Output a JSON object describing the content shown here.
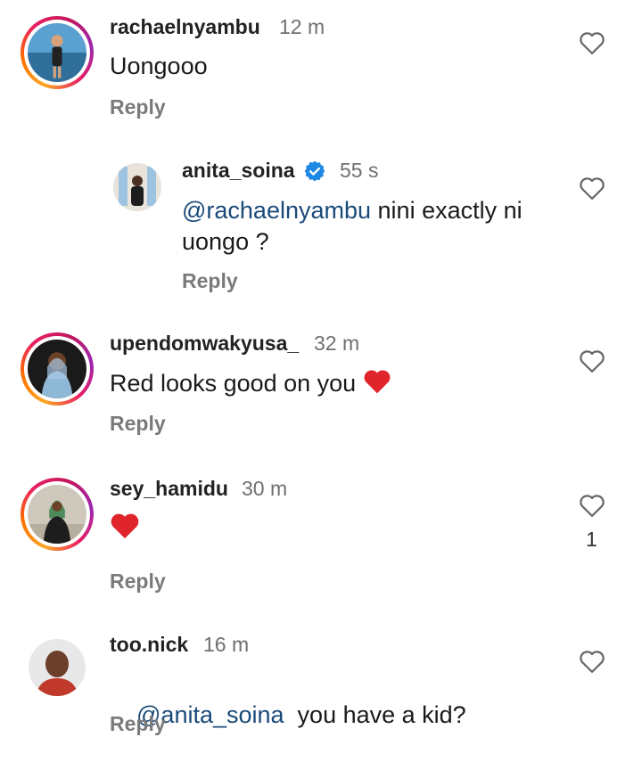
{
  "comments": [
    {
      "username": "rachaelnyambu",
      "time": "12 m",
      "text": "Uongooo",
      "reply": "Reply"
    },
    {
      "username": "anita_soina",
      "time": "55 s",
      "mention": "@rachaelnyambu",
      "text_line1": " nini exactly ni",
      "text_line2": "uongo ?",
      "reply": "Reply",
      "verified": true
    },
    {
      "username": "upendomwakyusa_",
      "time": "32 m",
      "text": "Red looks good on you",
      "emoji": "red-heart",
      "reply": "Reply"
    },
    {
      "username": "sey_hamidu",
      "time": "30 m",
      "emoji": "red-heart",
      "reply": "Reply",
      "likes": "1"
    },
    {
      "username": "too.nick",
      "time": "16 m",
      "mention": "@anita_soina",
      "text": "  you have a kid?",
      "reply": "Reply"
    }
  ],
  "colors": {
    "mention": "#1a4a7a",
    "verified": "#1e88e5",
    "heart_emoji": "#e0242c"
  }
}
